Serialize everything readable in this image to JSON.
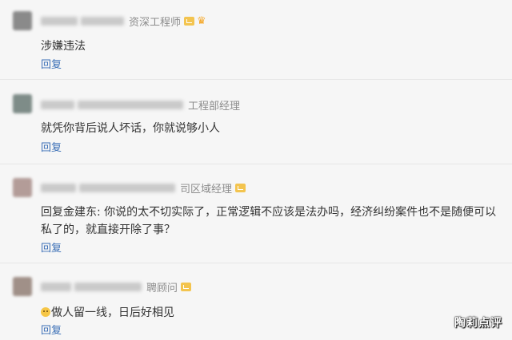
{
  "comments": [
    {
      "title_suffix": "资深工程师",
      "has_vip_badge": true,
      "has_crown": true,
      "text": "涉嫌违法",
      "reply": "回复",
      "avatar_color": "#8a8a8a"
    },
    {
      "title_suffix": "工程部经理",
      "has_vip_badge": false,
      "has_crown": false,
      "text": "就凭你背后说人坏话，你就说够小人",
      "reply": "回复",
      "avatar_color": "#7e8c88"
    },
    {
      "title_suffix": "司区域经理",
      "has_vip_badge": true,
      "has_crown": false,
      "text": "回复金建东: 你说的太不切实际了，正常逻辑不应该是法办吗，经济纠纷案件也不是随便可以私了的，就直接开除了事？",
      "reply": "回复",
      "avatar_color": "#b39c98"
    },
    {
      "title_suffix": "聘顾问",
      "has_vip_badge": true,
      "has_crown": false,
      "emoji": "smile-emoji-icon",
      "text": "做人留一线，日后好相见",
      "reply": "回复",
      "avatar_color": "#a09088"
    }
  ],
  "watermark": "陶莉点评",
  "colors": {
    "background": "#f6f6f6",
    "reply_link": "#3b6fb6",
    "title_gray": "#8c8c8c",
    "vip_badge": "#f3c44f"
  }
}
